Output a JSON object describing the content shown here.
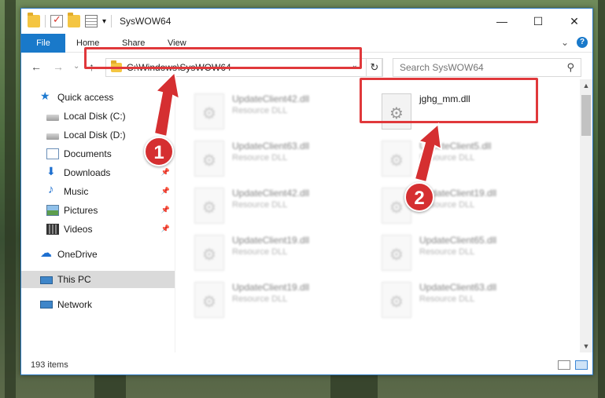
{
  "window": {
    "title": "SysWOW64",
    "controls": {
      "minimize": "—",
      "maximize": "☐",
      "close": "✕"
    }
  },
  "ribbon": {
    "tabs": [
      "File",
      "Home",
      "Share",
      "View"
    ],
    "expand": "⌄",
    "help": "?"
  },
  "nav": {
    "back": "←",
    "forward": "→",
    "recent": "⌄",
    "up": "↑",
    "address": "C:\\Windows\\SysWOW64",
    "address_drop": "⌄",
    "refresh": "↻",
    "search_placeholder": "Search SysWOW64",
    "search_icon": "⚲"
  },
  "sidebar": {
    "items": [
      {
        "label": "Quick access",
        "icon": "star-icon"
      },
      {
        "label": "Local Disk (C:)",
        "icon": "disk-icon"
      },
      {
        "label": "Local Disk (D:)",
        "icon": "disk-icon"
      },
      {
        "label": "Documents",
        "icon": "documents-icon"
      },
      {
        "label": "Downloads",
        "icon": "downloads-icon",
        "pinned": true
      },
      {
        "label": "Music",
        "icon": "music-icon",
        "pinned": true
      },
      {
        "label": "Pictures",
        "icon": "pictures-icon",
        "pinned": true
      },
      {
        "label": "Videos",
        "icon": "videos-icon",
        "pinned": true
      },
      {
        "label": "OneDrive",
        "icon": "onedrive-icon"
      },
      {
        "label": "This PC",
        "icon": "this-pc-icon",
        "selected": true
      },
      {
        "label": "Network",
        "icon": "network-icon"
      }
    ],
    "pin_glyph": "📌"
  },
  "files": [
    {
      "name": "UpdateClient42.dll",
      "type": "Resource DLL",
      "blurred": true
    },
    {
      "name": "jghg_mm.dll",
      "type": "",
      "blurred": false
    },
    {
      "name": "UpdateClient63.dll",
      "type": "Resource DLL",
      "blurred": true
    },
    {
      "name": "UpdateClient5.dll",
      "type": "Resource DLL",
      "blurred": true
    },
    {
      "name": "UpdateClient42.dll",
      "type": "Resource DLL",
      "blurred": true
    },
    {
      "name": "UpdateClient19.dll",
      "type": "Resource DLL",
      "blurred": true
    },
    {
      "name": "UpdateClient19.dll",
      "type": "Resource DLL",
      "blurred": true
    },
    {
      "name": "UpdateClient65.dll",
      "type": "Resource DLL",
      "blurred": true
    },
    {
      "name": "UpdateClient19.dll",
      "type": "Resource DLL",
      "blurred": true
    },
    {
      "name": "UpdateClient63.dll",
      "type": "Resource DLL",
      "blurred": true
    }
  ],
  "status": {
    "count": "193 items"
  },
  "annotations": {
    "step1": "1",
    "step2": "2",
    "color": "#d52f31"
  },
  "scroll": {
    "up": "▲",
    "down": "▼"
  }
}
